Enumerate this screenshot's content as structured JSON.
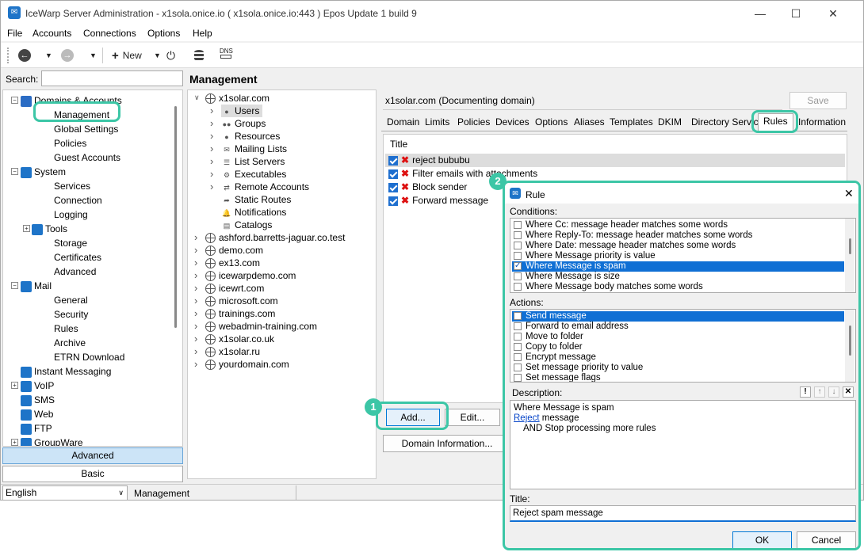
{
  "window": {
    "title": "IceWarp Server Administration - x1sola.onice.io ( x1sola.onice.io:443 ) Epos Update 1 build 9"
  },
  "menu": [
    "File",
    "Accounts",
    "Connections",
    "Options",
    "Help"
  ],
  "toolbar": {
    "new_label": "New",
    "dns_label": "DNS"
  },
  "search": {
    "label": "Search:",
    "value": ""
  },
  "tree": [
    {
      "label": "Domains & Accounts",
      "level": 0,
      "icon": "users-icon",
      "color": "#2b6cc4",
      "exp": "-"
    },
    {
      "label": "Management",
      "level": 1,
      "selected": true
    },
    {
      "label": "Global Settings",
      "level": 1
    },
    {
      "label": "Policies",
      "level": 1
    },
    {
      "label": "Guest Accounts",
      "level": 1
    },
    {
      "label": "System",
      "level": 0,
      "icon": "gear-icon",
      "color": "#1e74c8",
      "exp": "-"
    },
    {
      "label": "Services",
      "level": 1
    },
    {
      "label": "Connection",
      "level": 1
    },
    {
      "label": "Logging",
      "level": 1
    },
    {
      "label": "Tools",
      "level": 1,
      "icon": "tools-icon",
      "color": "#1e74c8",
      "exp": "+"
    },
    {
      "label": "Storage",
      "level": 1
    },
    {
      "label": "Certificates",
      "level": 1
    },
    {
      "label": "Advanced",
      "level": 1
    },
    {
      "label": "Mail",
      "level": 0,
      "icon": "mail-icon",
      "color": "#1e74c8",
      "exp": "-"
    },
    {
      "label": "General",
      "level": 1
    },
    {
      "label": "Security",
      "level": 1
    },
    {
      "label": "Rules",
      "level": 1
    },
    {
      "label": "Archive",
      "level": 1
    },
    {
      "label": "ETRN Download",
      "level": 1
    },
    {
      "label": "Instant Messaging",
      "level": 0,
      "icon": "chat-icon",
      "color": "#1e74c8"
    },
    {
      "label": "VoIP",
      "level": 0,
      "icon": "phone-icon",
      "color": "#1e74c8",
      "exp": "+"
    },
    {
      "label": "SMS",
      "level": 0,
      "icon": "sms-icon",
      "color": "#1e74c8"
    },
    {
      "label": "Web",
      "level": 0,
      "icon": "web-icon",
      "color": "#1e74c8"
    },
    {
      "label": "FTP",
      "level": 0,
      "icon": "ftp-icon",
      "color": "#1e74c8"
    },
    {
      "label": "GroupWare",
      "level": 0,
      "icon": "groupware-icon",
      "color": "#1e74c8",
      "exp": "+"
    }
  ],
  "mode_buttons": {
    "advanced": "Advanced",
    "basic": "Basic"
  },
  "status": {
    "language": "English",
    "section": "Management"
  },
  "page": {
    "heading": "Management"
  },
  "domains": {
    "root": "x1solar.com",
    "children": [
      "Users",
      "Groups",
      "Resources",
      "Mailing Lists",
      "List Servers",
      "Executables",
      "Remote Accounts",
      "Static Routes",
      "Notifications",
      "Catalogs"
    ],
    "others": [
      "ashford.barretts-jaguar.co.test",
      "demo.com",
      "ex13.com",
      "icewarpdemo.com",
      "icewrt.com",
      "microsoft.com",
      "trainings.com",
      "webadmin-training.com",
      "x1solar.co.uk",
      "x1solar.ru",
      "yourdomain.com"
    ]
  },
  "domain_panel": {
    "name": "x1solar.com (Documenting domain)",
    "save": "Save",
    "tabs": [
      "Domain",
      "Limits",
      "Policies",
      "Devices",
      "Options",
      "Aliases",
      "Templates",
      "DKIM",
      "Directory Service",
      "Rules",
      "Information"
    ],
    "active_tab": "Rules",
    "column": "Title",
    "rules": [
      "reject bububu",
      "Filter emails with attachments",
      "Block sender",
      "Forward message"
    ],
    "add": "Add...",
    "edit": "Edit...",
    "domain_info": "Domain Information..."
  },
  "badges": [
    "1",
    "2"
  ],
  "dialog": {
    "title": "Rule",
    "conditions_label": "Conditions:",
    "conditions": [
      {
        "text": "Where Cc: message header matches some words",
        "checked": false
      },
      {
        "text": "Where Reply-To: message header matches some words",
        "checked": false
      },
      {
        "text": "Where Date: message header matches some words",
        "checked": false
      },
      {
        "text": "Where Message priority is value",
        "checked": false
      },
      {
        "text": "Where Message is spam",
        "checked": true,
        "selected": true
      },
      {
        "text": "Where Message is size",
        "checked": false
      },
      {
        "text": "Where Message body matches some words",
        "checked": false
      }
    ],
    "actions_label": "Actions:",
    "actions": [
      {
        "text": "Send message",
        "selected": true
      },
      {
        "text": "Forward to email address"
      },
      {
        "text": "Move to folder"
      },
      {
        "text": "Copy to folder"
      },
      {
        "text": "Encrypt message"
      },
      {
        "text": "Set message priority to value"
      },
      {
        "text": "Set message flags"
      }
    ],
    "description_label": "Description:",
    "desc_line1": "Where Message is spam",
    "desc_link": "Reject",
    "desc_line2": " message",
    "desc_line3": "AND Stop processing more rules",
    "title_label": "Title:",
    "title_value": "Reject spam message",
    "ok": "OK",
    "cancel": "Cancel"
  },
  "colors": {
    "accent": "#3cc6a6",
    "selection": "#0f6fd4",
    "brand": "#1e74c8"
  }
}
